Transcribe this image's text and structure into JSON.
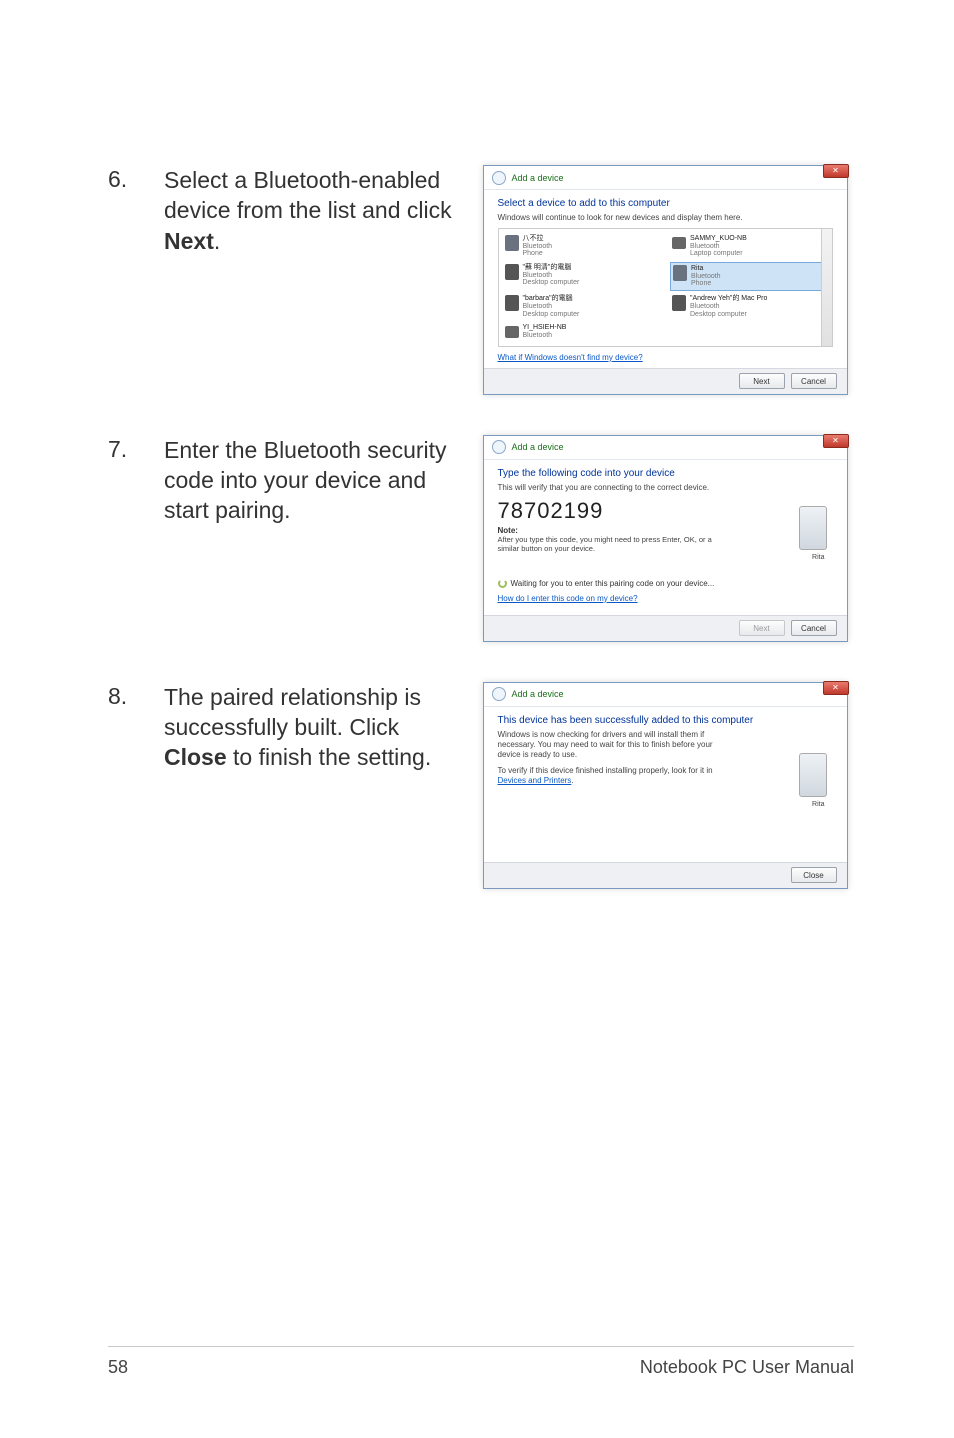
{
  "step6": {
    "num": "6.",
    "text_a": "Select a Bluetooth-enabled device from the list and click ",
    "text_b": "Next",
    "text_c": "."
  },
  "step7": {
    "num": "7.",
    "text": "Enter the Bluetooth security code into your device and start pairing."
  },
  "step8": {
    "num": "8.",
    "text_a": "The paired relationship is successfully built. Click ",
    "text_b": "Close",
    "text_c": " to finish the setting."
  },
  "dialog1": {
    "title": "Add a device",
    "heading": "Select a device to add to this computer",
    "sub": "Windows will continue to look for new devices and display them here.",
    "devices": [
      {
        "name": "八不拉",
        "t1": "Bluetooth",
        "t2": "Phone"
      },
      {
        "name": "SAMMY_KUO-NB",
        "t1": "Bluetooth",
        "t2": "Laptop computer"
      },
      {
        "name": "\"蘇 明清\"的電腦",
        "t1": "Bluetooth",
        "t2": "Desktop computer"
      },
      {
        "name": "Rita",
        "t1": "Bluetooth",
        "t2": "Phone",
        "sel": true
      },
      {
        "name": "\"barbara\"的電腦",
        "t1": "Bluetooth",
        "t2": "Desktop computer"
      },
      {
        "name": "\"Andrew Yeh\"的 Mac Pro",
        "t1": "Bluetooth",
        "t2": "Desktop computer"
      },
      {
        "name": "YI_HSIEH-NB",
        "t1": "Bluetooth",
        "t2": ""
      }
    ],
    "link": "What if Windows doesn't find my device?",
    "next": "Next",
    "cancel": "Cancel"
  },
  "dialog2": {
    "title": "Add a device",
    "heading": "Type the following code into your device",
    "sub": "This will verify that you are connecting to the correct device.",
    "code": "78702199",
    "note_h": "Note:",
    "note_t": "After you type this code, you might need to press Enter, OK, or a similar button on your device.",
    "phone_label": "Rita",
    "waiting": "Waiting for you to enter this pairing code on your device...",
    "link": "How do I enter this code on my device?",
    "next": "Next",
    "cancel": "Cancel"
  },
  "dialog3": {
    "title": "Add a device",
    "heading": "This device has been successfully added to this computer",
    "sub1": "Windows is now checking for drivers and will install them if necessary. You may need to wait for this to finish before your device is ready to use.",
    "sub2a": "To verify if this device finished installing properly, look for it in ",
    "sub2b": "Devices and Printers",
    "sub2c": ".",
    "phone_label": "Rita",
    "close": "Close"
  },
  "footer": {
    "page": "58",
    "title": "Notebook PC User Manual"
  }
}
